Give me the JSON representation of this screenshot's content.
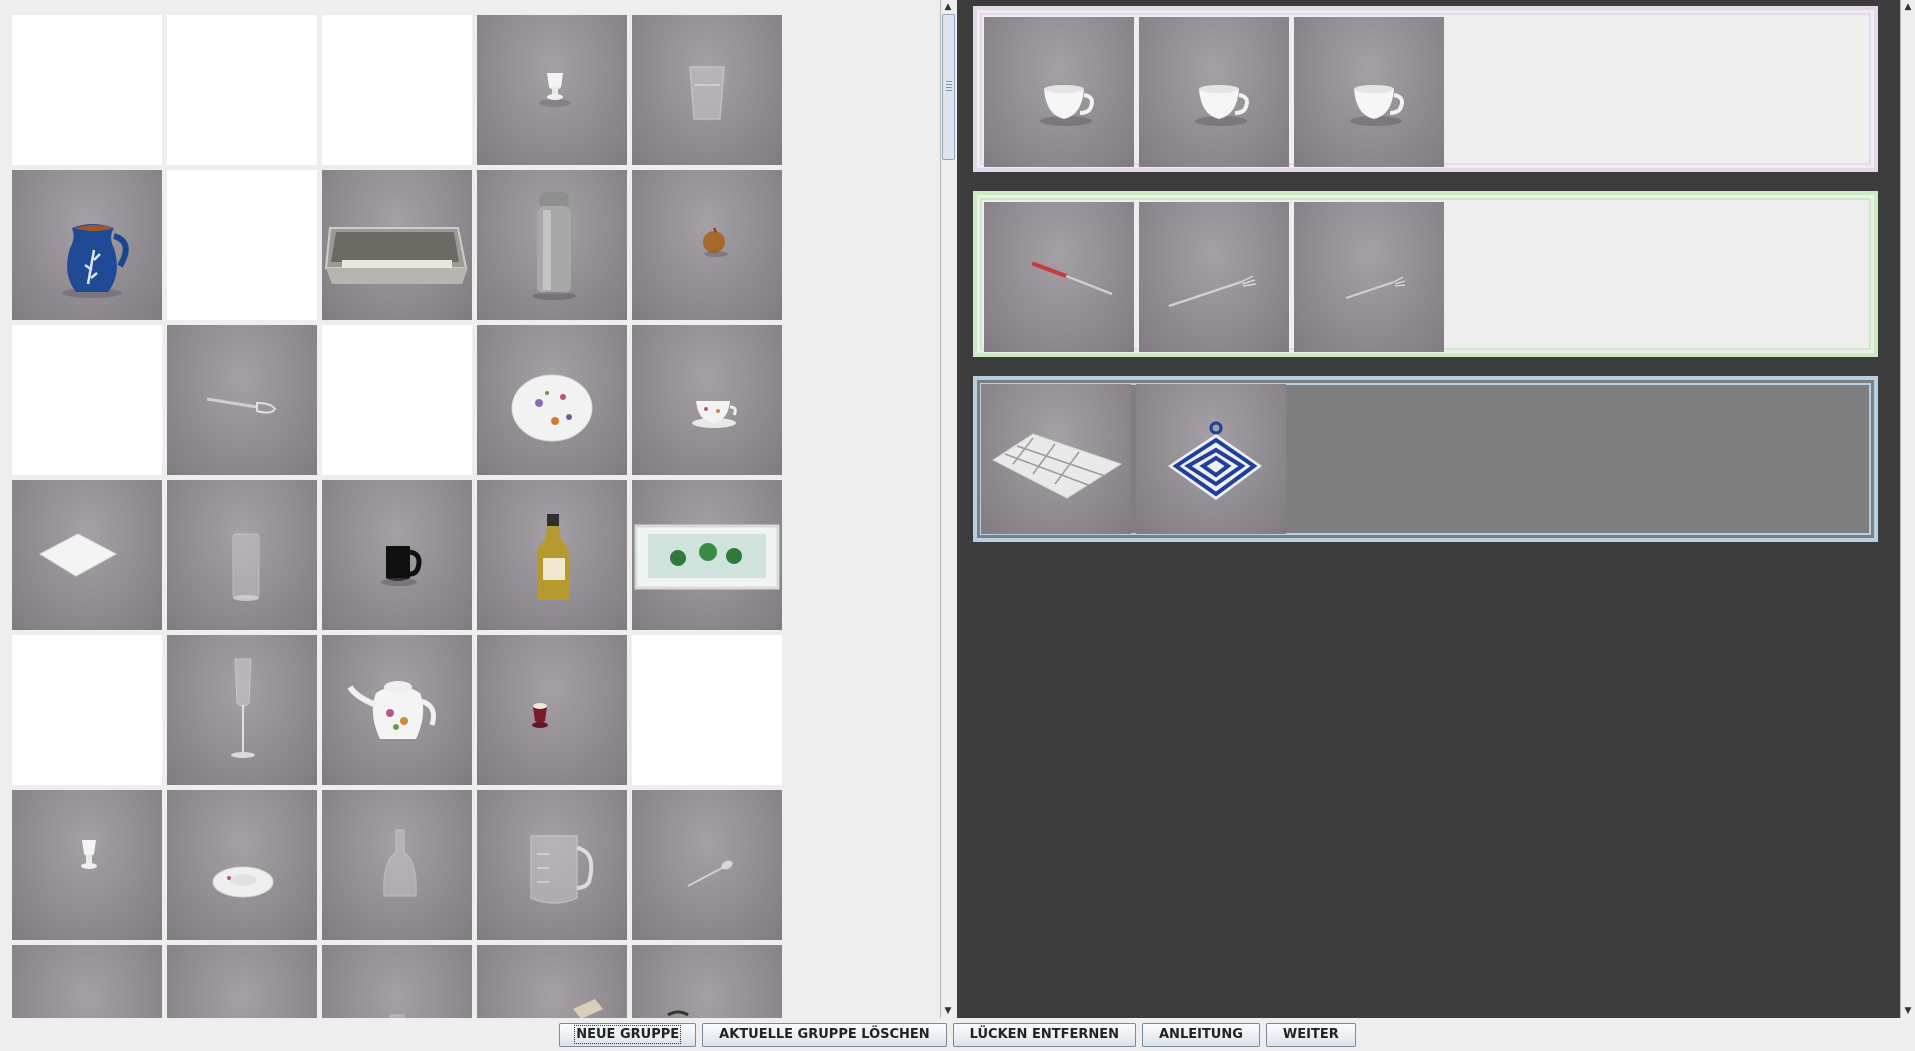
{
  "toolbar": {
    "new_group": "NEUE GRUPPE",
    "delete_group": "AKTUELLE GRUPPE LÖSCHEN",
    "remove_gaps": "LÜCKEN ENTFERNEN",
    "instructions": "ANLEITUNG",
    "next": "WEITER"
  },
  "colors": {
    "group_1_border": "#e6d8ea",
    "group_2_border": "#ccebc2",
    "group_3_border": "#b7cfe2",
    "group_3_background": "#7f7f7f",
    "groups_background": "#3c3c3c",
    "photo_background": "#938f95"
  },
  "pool": {
    "rows": [
      [
        "empty",
        "empty",
        "empty",
        "egg-cup-white-icon",
        "drinking-glass-icon"
      ],
      [
        "jug-blue-icon",
        "empty",
        "serving-tray-metal-icon",
        "thermos-flask-icon",
        "onion-icon"
      ],
      [
        "empty",
        "whisk-icon",
        "empty",
        "floral-plate-icon",
        "floral-teacup-icon"
      ],
      [
        "napkin-icon",
        "tall-glass-icon",
        "black-mug-icon",
        "oil-bottle-icon",
        "herb-tray-icon"
      ],
      [
        "empty",
        "champagne-flute-icon",
        "floral-teapot-icon",
        "red-egg-cup-icon",
        "empty"
      ],
      [
        "small-egg-cup-icon",
        "saucer-icon",
        "glass-carafe-icon",
        "measuring-jug-icon",
        "spoon-icon"
      ],
      [
        "partial-photo",
        "partial-photo",
        "partial-photo",
        "partial-photo",
        "partial-photo"
      ]
    ]
  },
  "groups": [
    {
      "items": [
        "white-cup-icon",
        "white-cup-icon",
        "white-cup-icon"
      ]
    },
    {
      "items": [
        "knife-icon",
        "fork-icon",
        "small-fork-icon"
      ]
    },
    {
      "items": [
        "tea-towel-icon",
        "potholder-icon"
      ]
    }
  ]
}
